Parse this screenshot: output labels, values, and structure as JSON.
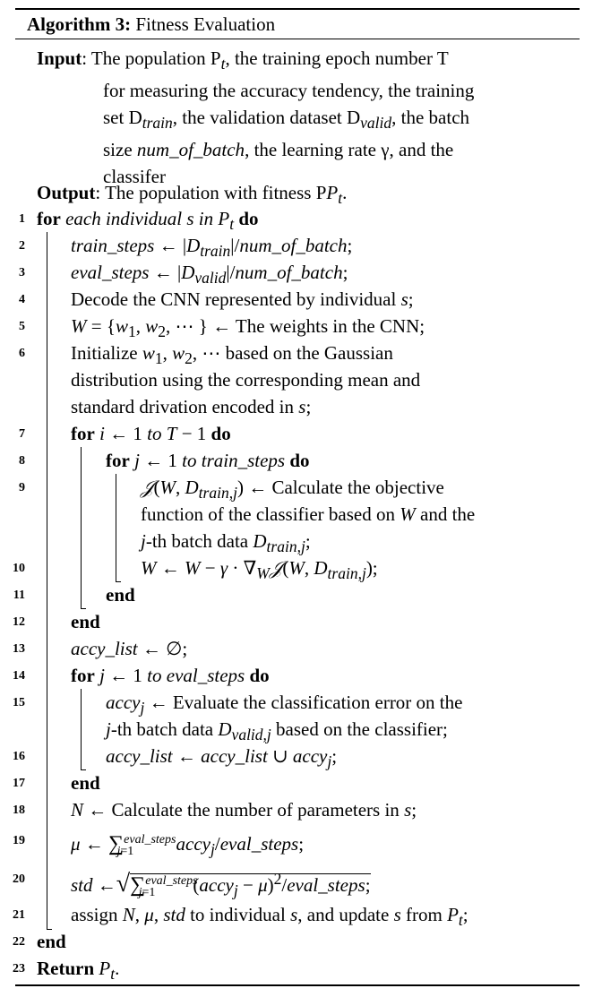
{
  "algorithm": {
    "caption_label": "Algorithm 3:",
    "caption_title": "Fitness Evaluation",
    "input_label": "Input",
    "input_text_line1": ": The population P",
    "input_text_line1_sub": "t",
    "input_text_line1_end": ", the training epoch number T",
    "input_text_rest": [
      "for measuring the accuracy tendency, the training",
      "set D",
      "train",
      ", the validation dataset D",
      "valid",
      ", the batch",
      "size ",
      "num_of_batch",
      ", the learning rate γ, and the",
      "classifer"
    ],
    "output_label": "Output",
    "output_text": ": The population with fitness P",
    "output_sub": "t",
    "output_end": ".",
    "lines": [
      {
        "num": "1"
      },
      {
        "num": "2"
      },
      {
        "num": "3"
      },
      {
        "num": "4",
        "text": "Decode the CNN represented by individual "
      },
      {
        "num": "5",
        "text": " ← The weights in the CNN;"
      },
      {
        "num": "6",
        "text": " based on the Gaussian"
      },
      {
        "num": "",
        "text": "distribution using the corresponding mean and"
      },
      {
        "num": "",
        "text": "standard drivation encoded in "
      },
      {
        "num": "7"
      },
      {
        "num": "8"
      },
      {
        "num": "9",
        "text": " ← Calculate the objective"
      },
      {
        "num": "",
        "text": "function of the classifier based on "
      },
      {
        "num": "",
        "text": "-th batch data "
      },
      {
        "num": "10"
      },
      {
        "num": "11"
      },
      {
        "num": "12"
      },
      {
        "num": "13"
      },
      {
        "num": "14"
      },
      {
        "num": "15",
        "text": " ← Evaluate the classification error on the"
      },
      {
        "num": "",
        "text": "-th batch data "
      },
      {
        "num": "16"
      },
      {
        "num": "17"
      },
      {
        "num": "18",
        "text": " ← Calculate the number of parameters in "
      },
      {
        "num": "19"
      },
      {
        "num": "20"
      },
      {
        "num": "21",
        "text": "assign "
      },
      {
        "num": "22"
      },
      {
        "num": "23"
      }
    ],
    "kw": {
      "for": "for",
      "do": "do",
      "end": "end",
      "return": "Return"
    }
  }
}
